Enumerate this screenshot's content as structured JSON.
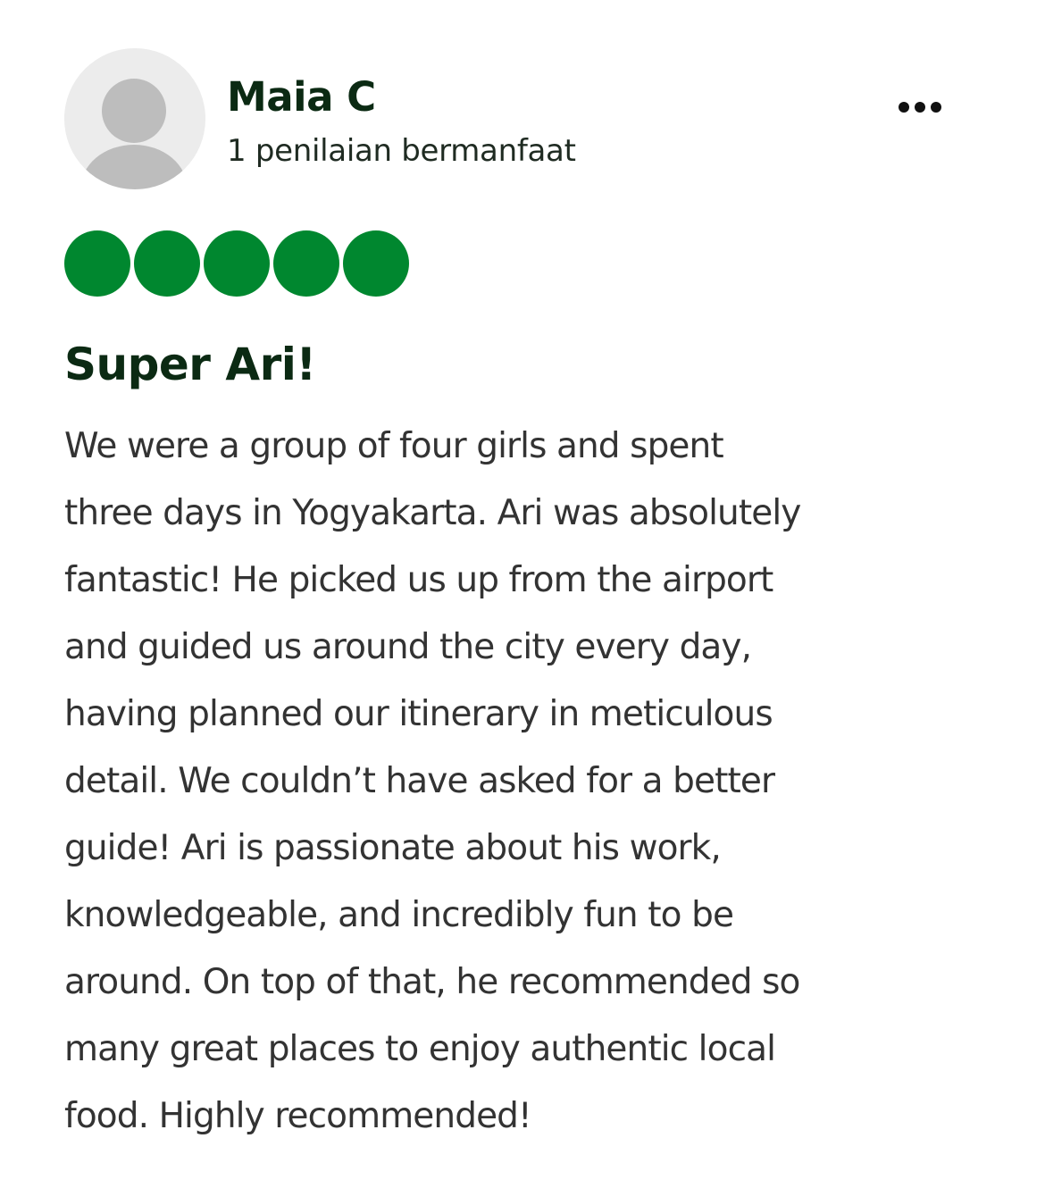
{
  "reviewer": {
    "name": "Maia C",
    "helpful_votes": "1 penilaian bermanfaat",
    "avatar_icon": "default-user-avatar-icon"
  },
  "menu": {
    "icon": "more-horizontal-icon"
  },
  "rating": {
    "value": 5,
    "max": 5,
    "color_filled": "#00872f",
    "color_empty": "#ffffff"
  },
  "review": {
    "title": "Super Ari!",
    "body_lines": [
      "We were a group of four girls and spent",
      "three days in Yogyakarta. Ari was absolutely",
      "fantastic! He picked us up from the airport",
      "and guided us around the city every day,",
      "having planned our itinerary in meticulous",
      "detail. We couldn’t have asked for a better",
      "guide! Ari is passionate about his work,",
      "knowledgeable, and incredibly fun to be",
      "around. On top of that, he recommended so",
      "many great places to enjoy authentic local",
      "food. Highly recommended!"
    ]
  },
  "colors": {
    "heading": "#0b2a13",
    "body_text": "#333333",
    "avatar_bg": "#ececec",
    "avatar_figure": "#bdbdbd"
  }
}
